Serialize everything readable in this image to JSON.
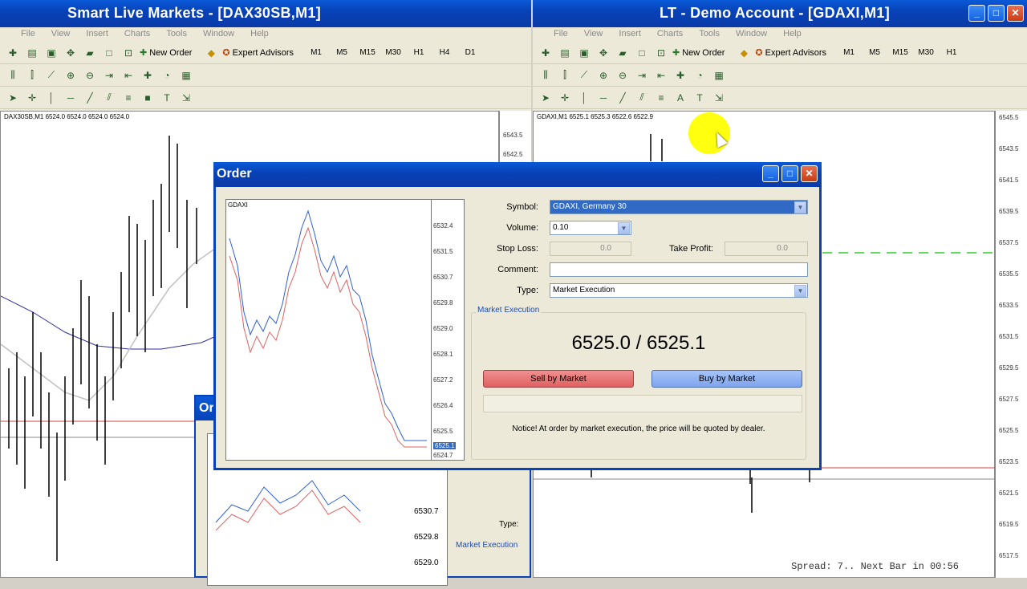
{
  "left_window": {
    "title": "Smart Live Markets - [DAX30SB,M1]",
    "menu": [
      "File",
      "View",
      "Insert",
      "Charts",
      "Tools",
      "Window",
      "Help"
    ],
    "toolbar": {
      "new_order": "New Order",
      "expert_advisors": "Expert Advisors",
      "timeframes": [
        "M1",
        "M5",
        "M15",
        "M30",
        "H1",
        "H4",
        "D1"
      ]
    },
    "chart_header": "DAX30SB,M1  6524.0 6524.0 6524.0 6524.0",
    "price_labels": [
      "6543.5",
      "6542.5"
    ]
  },
  "right_window": {
    "title": "LT - Demo Account - [GDAXI,M1]",
    "menu": [
      "File",
      "View",
      "Insert",
      "Charts",
      "Tools",
      "Window",
      "Help"
    ],
    "toolbar": {
      "new_order": "New Order",
      "expert_advisors": "Expert Advisors",
      "timeframes": [
        "M1",
        "M5",
        "M15",
        "M30",
        "H1"
      ]
    },
    "chart_header": "GDAXI,M1  6525.1 6525.3 6522.6 6522.9",
    "price_labels": [
      "6545.5",
      "6543.5",
      "6541.5",
      "6539.5",
      "6537.5",
      "6535.5",
      "6533.5",
      "6531.5",
      "6529.5",
      "6527.5",
      "6525.5",
      "6523.5",
      "6521.5",
      "6519.5",
      "6517.5"
    ],
    "spread_text": "Spread: 7.. Next Bar in 00:56"
  },
  "order": {
    "title": "Order",
    "chart_label": "GDAXI",
    "chart_prices": [
      "6532.4",
      "6531.5",
      "6530.7",
      "6529.8",
      "6529.0",
      "6528.1",
      "6527.2",
      "6526.4",
      "6525.5",
      "6525.1",
      "6524.7"
    ],
    "symbol_label": "Symbol:",
    "symbol_value": "GDAXI, Germany 30",
    "volume_label": "Volume:",
    "volume_value": "0.10",
    "stop_loss_label": "Stop Loss:",
    "stop_loss_value": "0.0",
    "take_profit_label": "Take Profit:",
    "take_profit_value": "0.0",
    "comment_label": "Comment:",
    "comment_value": "",
    "type_label": "Type:",
    "type_value": "Market Execution",
    "market_execution_label": "Market Execution",
    "price_text": "6525.0 / 6525.1",
    "sell_label": "Sell by Market",
    "buy_label": "Buy by Market",
    "notice": "Notice! At order by market execution, the price will be quoted by dealer."
  },
  "order2": {
    "title": "Or",
    "type_label": "Type:",
    "market_execution_label": "Market Execution",
    "chart_prices": [
      "6530.7",
      "6529.8",
      "6529.0"
    ]
  },
  "colors": {
    "title_blue": "#0842b8",
    "sell": "#e06060",
    "buy": "#7ea4ee",
    "cursor": "#ffff10"
  }
}
